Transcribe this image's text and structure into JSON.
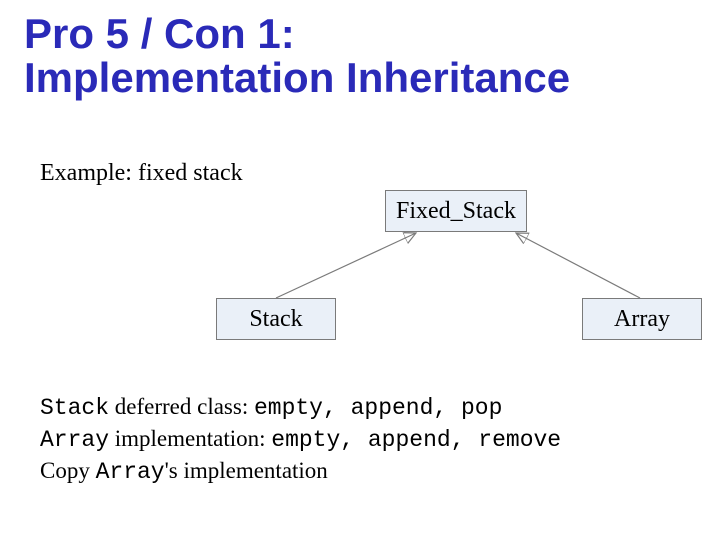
{
  "title_line1": "Pro 5 / Con 1:",
  "title_line2": "Implementation Inheritance",
  "example": "Example: fixed stack",
  "diagram": {
    "top": "Fixed_Stack",
    "left": "Stack",
    "right": "Array"
  },
  "desc": {
    "l1_code1": "Stack",
    "l1_text1": " deferred class: ",
    "l1_code2": "empty, append, pop",
    "l2_code1": " Array",
    "l2_text1": " implementation: ",
    "l2_code2": "empty, append, remove",
    "l3_text1": "Copy ",
    "l3_code1": "Array",
    "l3_text2": "'s implementation"
  }
}
